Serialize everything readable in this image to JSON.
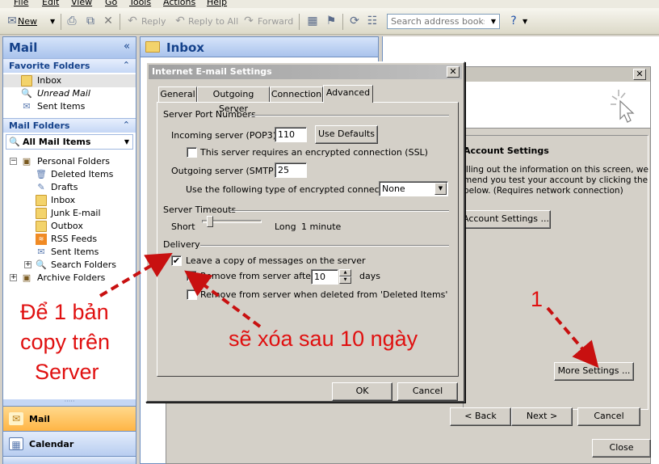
{
  "menubar": {
    "items": [
      "File",
      "Edit",
      "View",
      "Go",
      "Tools",
      "Actions",
      "Help"
    ]
  },
  "toolbar": {
    "new_label": "New",
    "reply_label": "Reply",
    "reply_all_label": "Reply to All",
    "forward_label": "Forward",
    "search_placeholder": "Search address books"
  },
  "nav": {
    "title": "Mail",
    "favorite_header": "Favorite Folders",
    "favorites": [
      "Inbox",
      "Unread Mail",
      "Sent Items"
    ],
    "mail_folders_header": "Mail Folders",
    "all_mail_items": "All Mail Items",
    "personal_folders": "Personal Folders",
    "folders": [
      "Deleted Items",
      "Drafts",
      "Inbox",
      "Junk E-mail",
      "Outbox",
      "RSS Feeds",
      "Sent Items",
      "Search Folders"
    ],
    "archive_folders": "Archive Folders",
    "grip": "·····",
    "buttons": [
      "Mail",
      "Calendar"
    ]
  },
  "inbox": {
    "title": "Inbox"
  },
  "wizard": {
    "heading": "Account Settings",
    "text_lines": [
      "illing out the information on this screen, we",
      "mend you test your account by clicking the",
      "below. (Requires network connection)"
    ],
    "test_button": "Account Settings ...",
    "more_settings": "More Settings ...",
    "back": "< Back",
    "next": "Next >",
    "cancel": "Cancel",
    "close": "Close",
    "close_x": "✕"
  },
  "dialog": {
    "title": "Internet E-mail Settings",
    "close_x": "✕",
    "tabs": [
      "General",
      "Outgoing Server",
      "Connection",
      "Advanced"
    ],
    "server_ports_header": "Server Port Numbers",
    "incoming_label": "Incoming server (POP3):",
    "incoming_value": "110",
    "use_defaults": "Use Defaults",
    "ssl_label": "This server requires an encrypted connection (SSL)",
    "outgoing_label": "Outgoing server (SMTP):",
    "outgoing_value": "25",
    "encryption_label": "Use the following type of encrypted connection:",
    "encryption_value": "None",
    "timeouts_header": "Server Timeouts",
    "short_label": "Short",
    "long_label": "Long",
    "timeout_value": "1 minute",
    "delivery_header": "Delivery",
    "leave_copy_label": "Leave a copy of messages on the server",
    "remove_after_label": "Remove from server after",
    "remove_days_value": "10",
    "days_label": "days",
    "remove_deleted_label": "Remove from server when deleted from 'Deleted Items'",
    "ok": "OK",
    "cancel": "Cancel",
    "check_mark": "✔"
  },
  "annotations": {
    "left_lines": [
      "Để 1 bản",
      "copy trên",
      "Server"
    ],
    "middle": "sẽ xóa sau  10 ngày",
    "step": "1"
  },
  "colors": {
    "accent": "#15428b",
    "annotation": "#e01010",
    "nav_selected": "#ffc35e"
  }
}
